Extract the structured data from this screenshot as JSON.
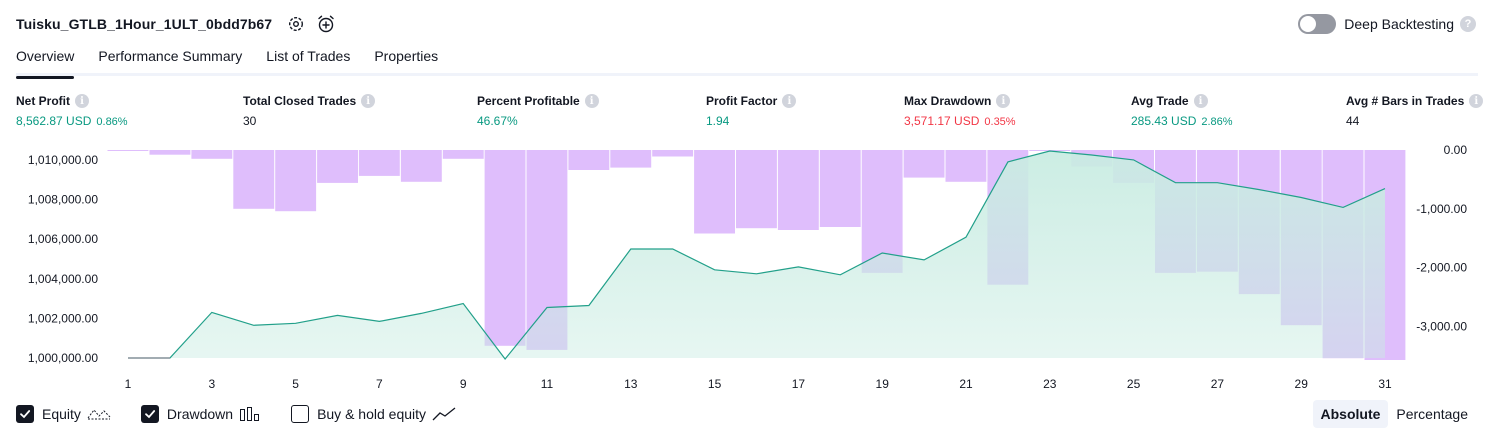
{
  "header": {
    "title": "Tuisku_GTLB_1Hour_1ULT_0bdd7b67",
    "deep_backtesting_label": "Deep Backtesting",
    "help_glyph": "?"
  },
  "tabs": [
    {
      "label": "Overview",
      "active": true
    },
    {
      "label": "Performance Summary",
      "active": false
    },
    {
      "label": "List of Trades",
      "active": false
    },
    {
      "label": "Properties",
      "active": false
    }
  ],
  "info_glyph": "i",
  "metrics": {
    "net_profit": {
      "label": "Net Profit",
      "value": "8,562.87 USD",
      "pct": "0.86%"
    },
    "total_closed_trades": {
      "label": "Total Closed Trades",
      "value": "30"
    },
    "percent_profitable": {
      "label": "Percent Profitable",
      "value": "46.67%"
    },
    "profit_factor": {
      "label": "Profit Factor",
      "value": "1.94"
    },
    "max_drawdown": {
      "label": "Max Drawdown",
      "value": "3,571.17 USD",
      "pct": "0.35%"
    },
    "avg_trade": {
      "label": "Avg Trade",
      "value": "285.43 USD",
      "pct": "2.86%"
    },
    "avg_bars": {
      "label": "Avg # Bars in Trades",
      "value": "44"
    }
  },
  "legend": {
    "equity": {
      "label": "Equity",
      "checked": true
    },
    "drawdown": {
      "label": "Drawdown",
      "checked": true
    },
    "buy_hold": {
      "label": "Buy & hold equity",
      "checked": false
    }
  },
  "mode": {
    "options": [
      "Absolute",
      "Percentage"
    ],
    "selected": "Absolute"
  },
  "colors": {
    "equity_line": "#22a08a",
    "equity_fill": "#c9ece2",
    "drawdown_bar": "#d9b3fb",
    "positive": "#089981",
    "negative": "#f23645"
  },
  "chart_data": {
    "type": "area",
    "x": [
      1,
      2,
      3,
      4,
      5,
      6,
      7,
      8,
      9,
      10,
      11,
      12,
      13,
      14,
      15,
      16,
      17,
      18,
      19,
      20,
      21,
      22,
      23,
      24,
      25,
      26,
      27,
      28,
      29,
      30,
      31
    ],
    "x_tick_labels": [
      "1",
      "3",
      "5",
      "7",
      "9",
      "11",
      "13",
      "15",
      "17",
      "19",
      "21",
      "23",
      "25",
      "27",
      "29",
      "31"
    ],
    "y_left_ticks": [
      "1,000,000.00",
      "1,002,000.00",
      "1,004,000.00",
      "1,006,000.00",
      "1,008,000.00",
      "1,010,000.00"
    ],
    "y_left_range": [
      1000000,
      1010500
    ],
    "y_right_ticks": [
      "0.00",
      "-1,000.00",
      "-2,000.00",
      "-3,000.00"
    ],
    "y_right_range": [
      -3571.17,
      0
    ],
    "series": [
      {
        "name": "Equity",
        "kind": "area",
        "axis": "left",
        "values": [
          1000000,
          1000000,
          1002300,
          1001650,
          1001750,
          1002150,
          1001850,
          1002250,
          1002750,
          999950,
          1002550,
          1002650,
          1005500,
          1005500,
          1004450,
          1004250,
          1004600,
          1004200,
          1005300,
          1004950,
          1006100,
          1009900,
          1010450,
          1010250,
          1010000,
          1008850,
          1008850,
          1008500,
          1008100,
          1007600,
          1008550
        ]
      },
      {
        "name": "Drawdown",
        "kind": "bar",
        "axis": "right",
        "values": [
          0,
          -80,
          -150,
          -1000,
          -1040,
          -560,
          -440,
          -540,
          -150,
          -3330,
          -3400,
          -340,
          -300,
          -110,
          -1420,
          -1330,
          -1360,
          -1310,
          -2090,
          -470,
          -540,
          -2290,
          0,
          -280,
          -560,
          -2090,
          -2070,
          -2450,
          -2980,
          -3540,
          -3571.17
        ]
      }
    ]
  }
}
